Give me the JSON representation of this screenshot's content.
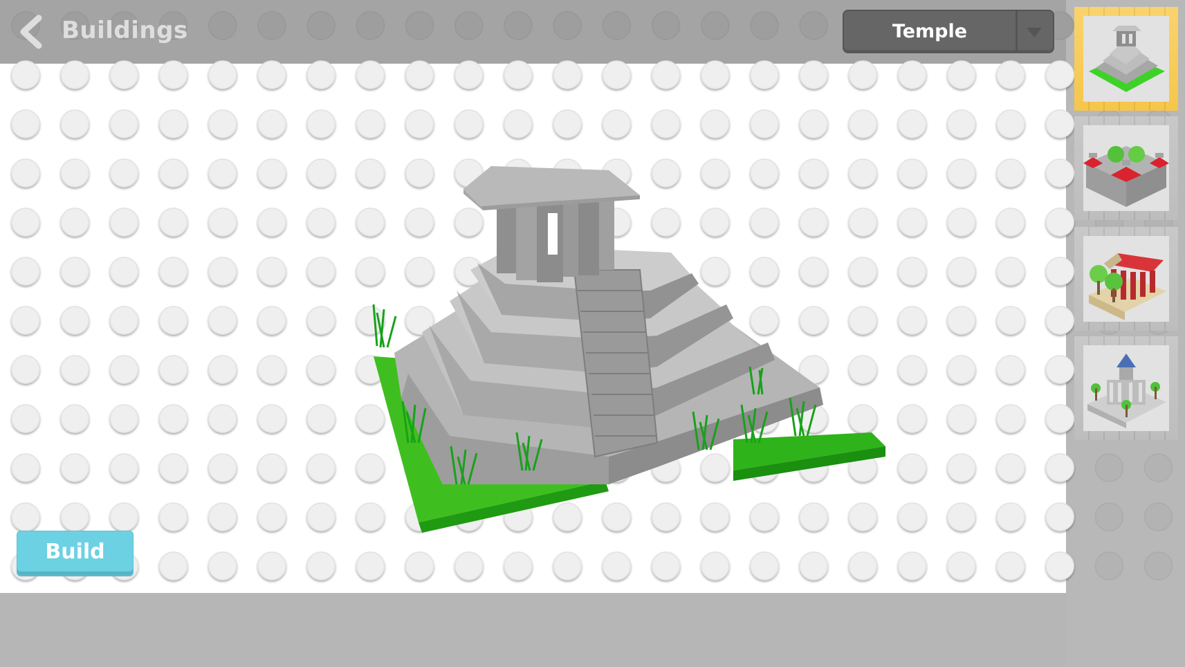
{
  "header": {
    "title": "Buildings",
    "back_icon": "chevron-left-icon"
  },
  "selector": {
    "selected": "Temple",
    "dropdown_icon": "triangle-down-icon"
  },
  "actions": {
    "build_label": "Build"
  },
  "preview": {
    "model_name": "Temple",
    "description": "Grey stepped pyramid temple with green grass base"
  },
  "thumbnails": [
    {
      "name": "Temple",
      "selected": true,
      "accent": "#f6c64a"
    },
    {
      "name": "Fortress",
      "selected": false,
      "accent": "#d9232e"
    },
    {
      "name": "Greek temple",
      "selected": false,
      "accent": "#c7262c"
    },
    {
      "name": "Palace",
      "selected": false,
      "accent": "#4a6fb5"
    }
  ],
  "colors": {
    "topbar": "#a4a4a4",
    "canvas": "#ffffff",
    "sidebar": "#b8b8b8",
    "build_button": "#6bd1e3",
    "dropdown": "#666666",
    "selected_frame": "#f6c64a"
  }
}
